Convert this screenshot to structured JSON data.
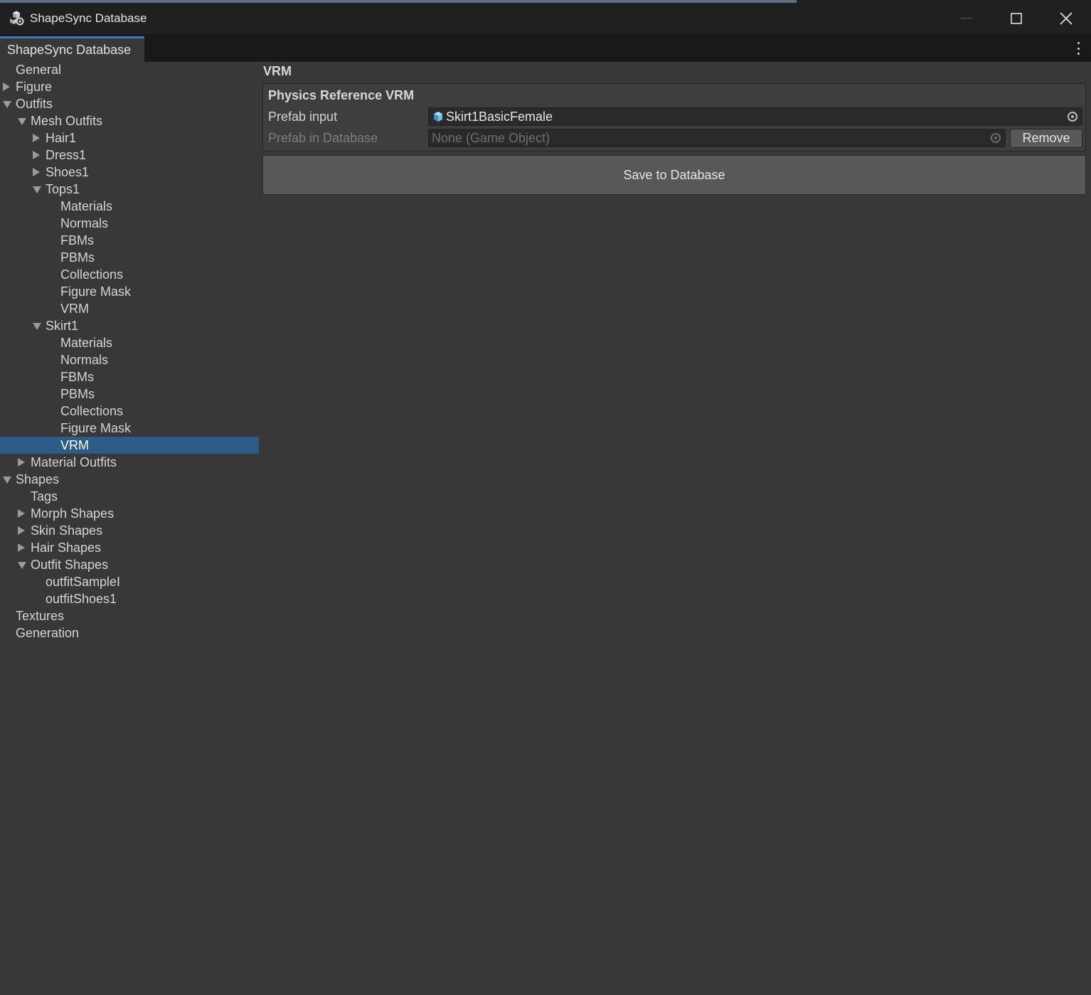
{
  "window": {
    "title": "ShapeSync Database",
    "icon": "unity-cubes-icon",
    "controls": [
      "minimize-icon",
      "maximize-icon",
      "close-icon"
    ]
  },
  "tab": {
    "label": "ShapeSync Database",
    "menu_icon": "kebab-menu-icon"
  },
  "tree": [
    {
      "label": "General",
      "depth": 0,
      "toggle": "none"
    },
    {
      "label": "Figure",
      "depth": 0,
      "toggle": "collapsed"
    },
    {
      "label": "Outfits",
      "depth": 0,
      "toggle": "expanded"
    },
    {
      "label": "Mesh Outfits",
      "depth": 1,
      "toggle": "expanded"
    },
    {
      "label": "Hair1",
      "depth": 2,
      "toggle": "collapsed"
    },
    {
      "label": "Dress1",
      "depth": 2,
      "toggle": "collapsed"
    },
    {
      "label": "Shoes1",
      "depth": 2,
      "toggle": "collapsed"
    },
    {
      "label": "Tops1",
      "depth": 2,
      "toggle": "expanded"
    },
    {
      "label": "Materials",
      "depth": 3,
      "toggle": "none"
    },
    {
      "label": "Normals",
      "depth": 3,
      "toggle": "none"
    },
    {
      "label": "FBMs",
      "depth": 3,
      "toggle": "none"
    },
    {
      "label": "PBMs",
      "depth": 3,
      "toggle": "none"
    },
    {
      "label": "Collections",
      "depth": 3,
      "toggle": "none"
    },
    {
      "label": "Figure Mask",
      "depth": 3,
      "toggle": "none"
    },
    {
      "label": "VRM",
      "depth": 3,
      "toggle": "none"
    },
    {
      "label": "Skirt1",
      "depth": 2,
      "toggle": "expanded"
    },
    {
      "label": "Materials",
      "depth": 3,
      "toggle": "none"
    },
    {
      "label": "Normals",
      "depth": 3,
      "toggle": "none"
    },
    {
      "label": "FBMs",
      "depth": 3,
      "toggle": "none"
    },
    {
      "label": "PBMs",
      "depth": 3,
      "toggle": "none"
    },
    {
      "label": "Collections",
      "depth": 3,
      "toggle": "none"
    },
    {
      "label": "Figure Mask",
      "depth": 3,
      "toggle": "none"
    },
    {
      "label": "VRM",
      "depth": 3,
      "toggle": "none",
      "selected": true
    },
    {
      "label": "Material Outfits",
      "depth": 1,
      "toggle": "collapsed"
    },
    {
      "label": "Shapes",
      "depth": 0,
      "toggle": "expanded"
    },
    {
      "label": "Tags",
      "depth": 1,
      "toggle": "none"
    },
    {
      "label": "Morph Shapes",
      "depth": 1,
      "toggle": "collapsed"
    },
    {
      "label": "Skin Shapes",
      "depth": 1,
      "toggle": "collapsed"
    },
    {
      "label": "Hair Shapes",
      "depth": 1,
      "toggle": "collapsed"
    },
    {
      "label": "Outfit Shapes",
      "depth": 1,
      "toggle": "expanded"
    },
    {
      "label": "outfitSampleI",
      "depth": 2,
      "toggle": "none"
    },
    {
      "label": "outfitShoes1",
      "depth": 2,
      "toggle": "none"
    },
    {
      "label": "Textures",
      "depth": 0,
      "toggle": "none"
    },
    {
      "label": "Generation",
      "depth": 0,
      "toggle": "none"
    }
  ],
  "main": {
    "section_title": "VRM",
    "panel": {
      "title": "Physics Reference VRM",
      "prefab_input": {
        "label": "Prefab input",
        "value": "Skirt1BasicFemale",
        "icon": "prefab-cube-icon"
      },
      "prefab_in_database": {
        "label": "Prefab in Database",
        "value": "None (Game Object)"
      },
      "remove_label": "Remove"
    },
    "save_label": "Save to Database"
  },
  "colors": {
    "background": "#383838",
    "selection": "#2c5d87",
    "tab_accent": "#3a79bb",
    "titlebar": "#202020"
  }
}
